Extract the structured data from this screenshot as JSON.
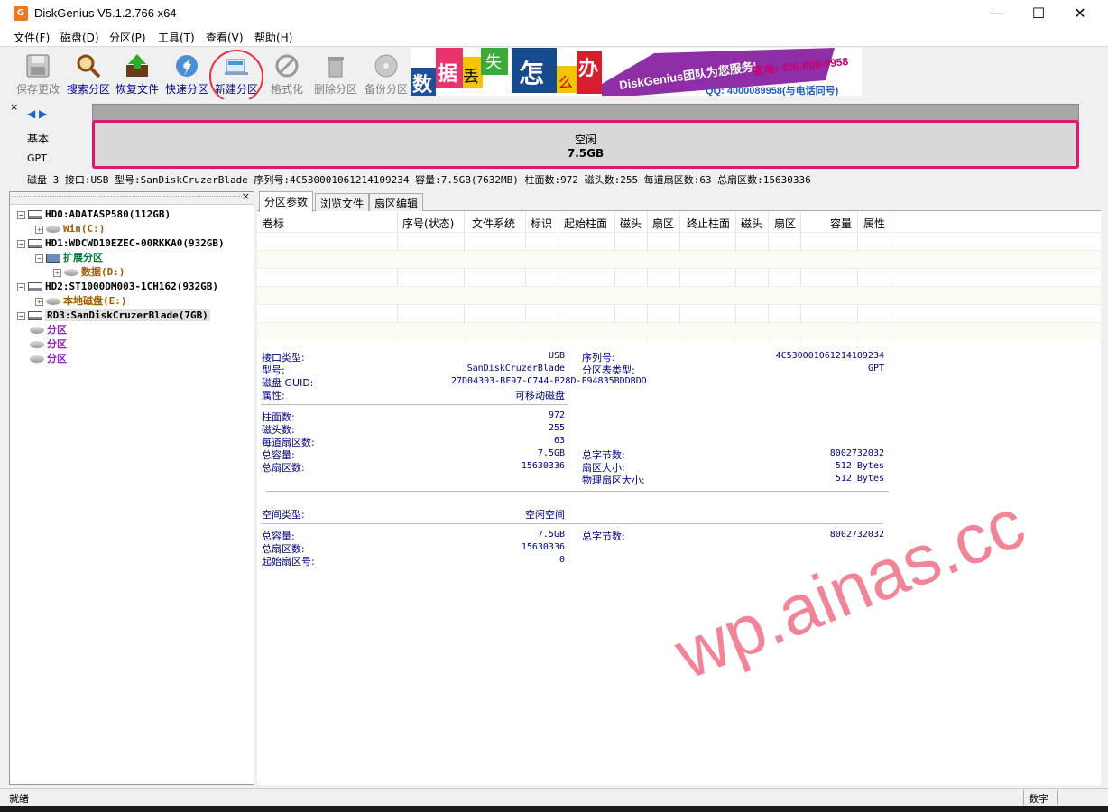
{
  "window": {
    "title": "DiskGenius V5.1.2.766 x64",
    "minimize": "—",
    "maximize": "☐",
    "close": "✕"
  },
  "menu": [
    "文件(F)",
    "磁盘(D)",
    "分区(P)",
    "工具(T)",
    "查看(V)",
    "帮助(H)"
  ],
  "toolbar": [
    {
      "label": "保存更改",
      "enabled": false
    },
    {
      "label": "搜索分区",
      "enabled": true
    },
    {
      "label": "恢复文件",
      "enabled": true
    },
    {
      "label": "快速分区",
      "enabled": true
    },
    {
      "label": "新建分区",
      "enabled": true,
      "highlighted": true
    },
    {
      "label": "格式化",
      "enabled": false
    },
    {
      "label": "删除分区",
      "enabled": false
    },
    {
      "label": "备份分区",
      "enabled": false
    }
  ],
  "banner": {
    "chars": [
      "数",
      "据",
      "丢",
      "失",
      "怎",
      "么",
      "办"
    ],
    "brand": "DiskGenius团队为您服务!",
    "phone": "致电: 400-008-9958",
    "qq": "QQ: 4000089958(与电话同号)"
  },
  "diskmap": {
    "close": "×",
    "nav": "◀ ▶",
    "kind": "基本",
    "type": "GPT",
    "partition_label": "空闲",
    "partition_size": "7.5GB"
  },
  "diskinfo": "磁盘 3 接口:USB  型号:SanDiskCruzerBlade  序列号:4C530001061214109234  容量:7.5GB(7632MB)  柱面数:972  磁头数:255  每道扇区数:63  总扇区数:15630336",
  "tree": {
    "close": "×",
    "nodes": [
      {
        "label": "HD0:ADATASP580(112GB)",
        "color": "black"
      },
      {
        "label": "Win(C:)",
        "color": "brown"
      },
      {
        "label": "HD1:WDCWD10EZEC-00RKKA0(932GB)",
        "color": "black"
      },
      {
        "label": "扩展分区",
        "color": "green"
      },
      {
        "label": "数据(D:)",
        "color": "brown"
      },
      {
        "label": "HD2:ST1000DM003-1CH162(932GB)",
        "color": "black"
      },
      {
        "label": "本地磁盘(E:)",
        "color": "brown"
      },
      {
        "label": "RD3:SanDiskCruzerBlade(7GB)",
        "color": "black",
        "selected": true
      },
      {
        "label": "分区",
        "color": "purple"
      },
      {
        "label": "分区",
        "color": "purple"
      },
      {
        "label": "分区",
        "color": "purple"
      }
    ]
  },
  "tabs": [
    "分区参数",
    "浏览文件",
    "扇区编辑"
  ],
  "grid_headers": [
    "卷标",
    "序号(状态)",
    "文件系统",
    "标识",
    "起始柱面",
    "磁头",
    "扇区",
    "终止柱面",
    "磁头",
    "扇区",
    "容量",
    "属性"
  ],
  "details": {
    "interface_label": "接口类型:",
    "interface": "USB",
    "serial_label": "序列号:",
    "serial": "4C530001061214109234",
    "model_label": "型号:",
    "model": "SanDiskCruzerBlade",
    "pt_label": "分区表类型:",
    "pt": "GPT",
    "guid_label": "磁盘 GUID:",
    "guid": "27D04303-BF97-C744-B28D-F94835BDDBDD",
    "attr_label": "属性:",
    "attr": "可移动磁盘",
    "cyl_label": "柱面数:",
    "cyl": "972",
    "heads_label": "磁头数:",
    "heads": "255",
    "spt_label": "每道扇区数:",
    "spt": "63",
    "cap_label": "总容量:",
    "cap": "7.5GB",
    "bytes_label": "总字节数:",
    "bytes": "8002732032",
    "sectors_label": "总扇区数:",
    "sectors": "15630336",
    "ss_label": "扇区大小:",
    "ss": "512 Bytes",
    "pss_label": "物理扇区大小:",
    "pss": "512 Bytes",
    "space_label": "空间类型:",
    "space": "空闲空间",
    "cap2_label": "总容量:",
    "cap2": "7.5GB",
    "bytes2_label": "总字节数:",
    "bytes2": "8002732032",
    "sectors2_label": "总扇区数:",
    "sectors2": "15630336",
    "start_label": "起始扇区号:",
    "start": "0"
  },
  "status": {
    "left": "就绪",
    "right": "数字"
  },
  "watermark": "wp.ainas.cc",
  "colors": {
    "accent_pink": "#e0156e",
    "circle_red": "#e8323c",
    "label_blue": "#000080"
  }
}
